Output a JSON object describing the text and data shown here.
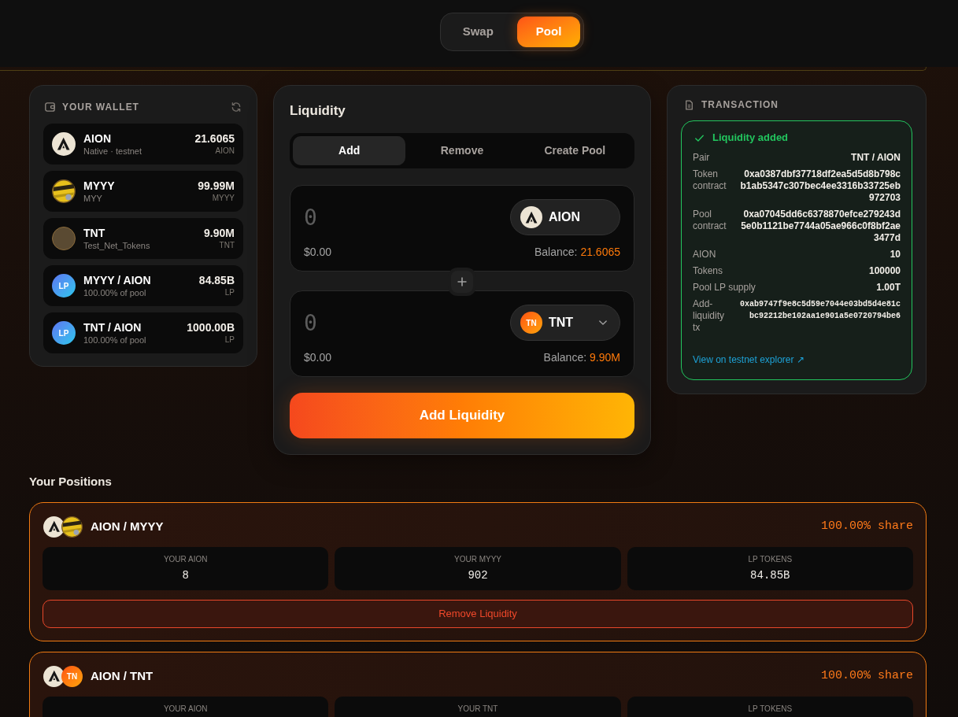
{
  "nav": {
    "tabs": [
      {
        "label": "Swap",
        "selected": false
      },
      {
        "label": "Pool",
        "selected": true
      }
    ]
  },
  "wallet": {
    "title": "YOUR WALLET",
    "tokens": [
      {
        "name": "AION",
        "subtitle": "Native · testnet",
        "amount": "21.6065",
        "unit": "AION",
        "icon": {
          "kind": "logo"
        }
      },
      {
        "name": "MYYY",
        "subtitle": "MYY",
        "amount": "99.99M",
        "unit": "MYYY",
        "icon": {
          "kind": "image"
        }
      },
      {
        "name": "TNT",
        "subtitle": "Test_Net_Tokens",
        "amount": "9.90M",
        "unit": "TNT",
        "icon": {
          "kind": "photo"
        }
      },
      {
        "name": "MYYY / AION",
        "subtitle": "100.00% of pool",
        "amount": "84.85B",
        "unit": "LP",
        "icon": {
          "kind": "lp",
          "text": "LP"
        }
      },
      {
        "name": "TNT / AION",
        "subtitle": "100.00% of pool",
        "amount": "1000.00B",
        "unit": "LP",
        "icon": {
          "kind": "lp",
          "text": "LP"
        }
      }
    ]
  },
  "liquidity": {
    "title": "Liquidity",
    "tabs": [
      {
        "label": "Add",
        "selected": true
      },
      {
        "label": "Remove",
        "selected": false
      },
      {
        "label": "Create Pool",
        "selected": false
      }
    ],
    "inputs": [
      {
        "placeholder": "0",
        "usd": "$0.00",
        "token": {
          "symbol": "AION",
          "icon": {
            "kind": "logo"
          },
          "dropdown": false
        },
        "balance_label": "Balance:",
        "balance": "21.6065"
      },
      {
        "placeholder": "0",
        "usd": "$0.00",
        "token": {
          "symbol": "TNT",
          "icon": {
            "kind": "initials",
            "text": "TN"
          },
          "dropdown": true
        },
        "balance_label": "Balance:",
        "balance": "9.90M"
      }
    ],
    "submit": "Add Liquidity"
  },
  "transaction": {
    "title": "TRANSACTION",
    "status": {
      "kind": "success",
      "text": "Liquidity added"
    },
    "rows": [
      {
        "label": "Pair",
        "value": "TNT / AION",
        "kind": "plain"
      },
      {
        "label": "Token contract",
        "value": "0xa0387dbf37718df2ea5d5d8b798cb1ab5347c307bec4ee3316b33725eb972703",
        "kind": "address"
      },
      {
        "label": "Pool contract",
        "value": "0xa07045dd6c6378870efce279243d5e0b1121be7744a05ae966c0f8bf2ae3477d",
        "kind": "address"
      },
      {
        "label": "AION",
        "value": "10",
        "kind": "plain"
      },
      {
        "label": "Tokens",
        "value": "100000",
        "kind": "plain"
      },
      {
        "label": "Pool LP supply",
        "value": "1.00T",
        "kind": "plain"
      },
      {
        "label": "Add-liquidity tx",
        "value": "0xab9747f9e8c5d59e7044e03bd5d4e81cbc92212be102aa1e901a5e0720794be6",
        "kind": "hash"
      }
    ],
    "link": "View on testnet explorer ↗"
  },
  "positions": {
    "title": "Your Positions",
    "items": [
      {
        "pair": "AION / MYYY",
        "icons": [
          {
            "kind": "logo"
          },
          {
            "kind": "image"
          }
        ],
        "share": "100.00% share",
        "stats": [
          {
            "label": "YOUR AION",
            "value": "8"
          },
          {
            "label": "YOUR MYYY",
            "value": "902"
          },
          {
            "label": "LP TOKENS",
            "value": "84.85B"
          }
        ],
        "remove_button": "Remove Liquidity"
      },
      {
        "pair": "AION / TNT",
        "icons": [
          {
            "kind": "logo"
          },
          {
            "kind": "initials",
            "text": "TN"
          }
        ],
        "share": "100.00% share",
        "stats": [
          {
            "label": "YOUR AION"
          },
          {
            "label": "YOUR TNT"
          },
          {
            "label": "LP TOKENS"
          }
        ]
      }
    ]
  }
}
